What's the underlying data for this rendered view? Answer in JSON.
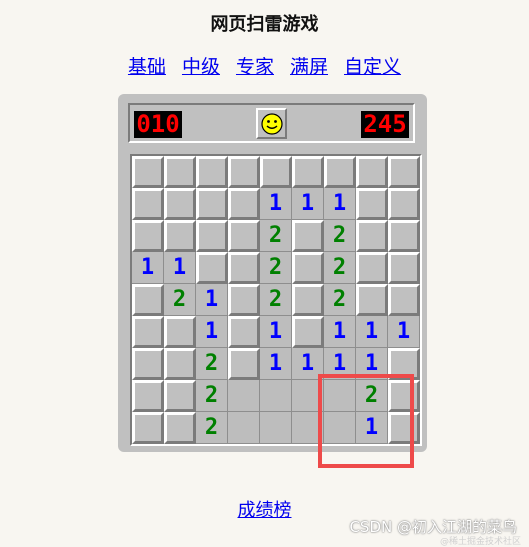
{
  "page": {
    "title": "网页扫雷游戏"
  },
  "levels": [
    {
      "label": "基础"
    },
    {
      "label": "中级"
    },
    {
      "label": "专家"
    },
    {
      "label": "满屏"
    },
    {
      "label": "自定义"
    }
  ],
  "game": {
    "mines_remaining": "010",
    "timer": "245",
    "face": "smiley-face-icon",
    "rows": [
      [
        "C",
        "C",
        "C",
        "C",
        "C",
        "C",
        "C",
        "C",
        "C"
      ],
      [
        "C",
        "C",
        "C",
        "C",
        "1",
        "1",
        "1",
        "C",
        "C"
      ],
      [
        "C",
        "C",
        "C",
        "C",
        "2",
        "C",
        "2",
        "C",
        "C"
      ],
      [
        "1",
        "1",
        "C",
        "C",
        "2",
        "C",
        "2",
        "C",
        "C"
      ],
      [
        "C",
        "2",
        "1",
        "C",
        "2",
        "C",
        "2",
        "C",
        "C"
      ],
      [
        "C",
        "C",
        "1",
        "C",
        "1",
        "C",
        "1",
        "1",
        "1"
      ],
      [
        "C",
        "C",
        "2",
        "C",
        "1",
        "1",
        "1",
        "1",
        "C"
      ],
      [
        "C",
        "C",
        "2",
        "",
        "",
        "",
        "",
        "2",
        "C"
      ],
      [
        "C",
        "C",
        "2",
        "",
        "",
        "",
        "",
        "1",
        "C"
      ]
    ],
    "rows_note_legend": {
      "C": "covered",
      "": "open-empty"
    }
  },
  "footer": {
    "leaderboard_label": "成绩榜"
  },
  "watermark": {
    "text": "CSDN @初入江湖的菜鸟",
    "subtext": "@稀土掘金技术社区"
  },
  "colors": {
    "one": "#0000ff",
    "two": "#008000",
    "highlight": "#ee4a4a",
    "link": "#0000ee"
  }
}
